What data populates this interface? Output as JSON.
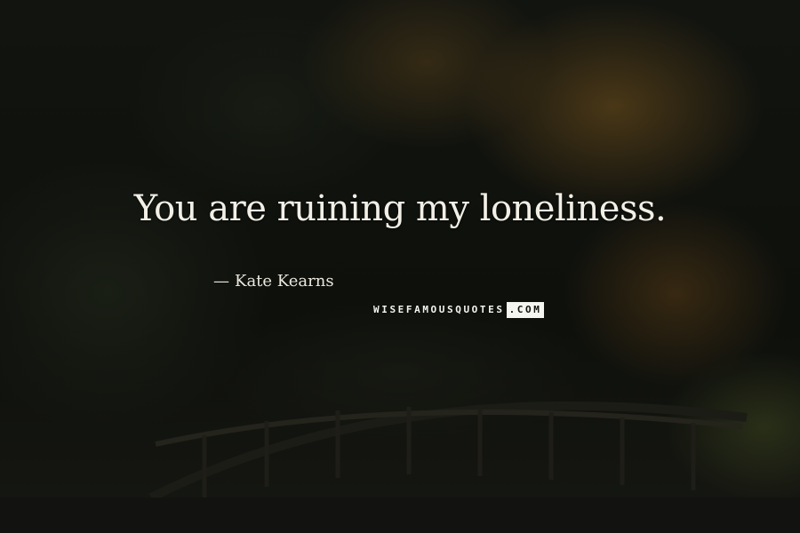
{
  "quote": {
    "text": "You are ruining my loneliness.",
    "author": "Kate Kearns",
    "author_prefix": "—"
  },
  "watermark": {
    "main": "WISEFAMOUSQUOTES",
    "tail": ".COM"
  },
  "colors": {
    "text": "#f2efe6",
    "background": "#0d0e0b",
    "foliage_autumn": "#785520"
  }
}
